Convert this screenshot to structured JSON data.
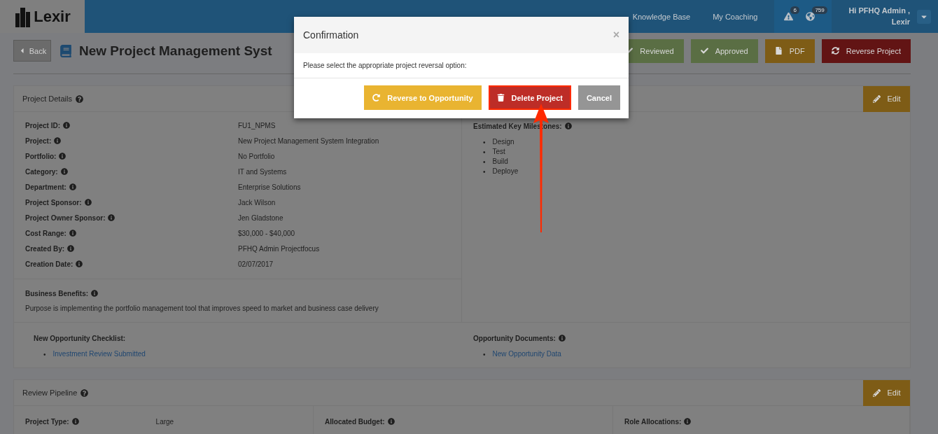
{
  "brand": {
    "name": "Lexir"
  },
  "nav": {
    "items": [
      {
        "label": "Knowledge Base"
      },
      {
        "label": "My Coaching"
      }
    ],
    "alerts": [
      {
        "kind": "warning",
        "count": "6"
      },
      {
        "kind": "globe",
        "count": "759"
      }
    ],
    "user": {
      "greeting": "Hi PFHQ Admin ,",
      "name": "Lexir"
    }
  },
  "header": {
    "back": "Back",
    "title": "New Project Management Syst",
    "actions": [
      {
        "kind": "check",
        "label": "Reviewed",
        "color": "#5a6e44"
      },
      {
        "kind": "check",
        "label": "Approved",
        "color": "#5a6e44"
      },
      {
        "kind": "file",
        "label": "PDF",
        "color": "#7e5c16"
      },
      {
        "kind": "refresh",
        "label": "Reverse Project",
        "color": "#621414"
      }
    ]
  },
  "details": {
    "title": "Project Details",
    "edit": "Edit",
    "fields": [
      {
        "label": "Project ID:",
        "value": "FU1_NPMS"
      },
      {
        "label": "Project:",
        "value": "New Project Management System Integration"
      },
      {
        "label": "Portfolio:",
        "value": "No Portfolio"
      },
      {
        "label": "Category:",
        "value": "IT and Systems"
      },
      {
        "label": "Department:",
        "value": "Enterprise Solutions"
      },
      {
        "label": "Project Sponsor:",
        "value": "Jack Wilson"
      },
      {
        "label": "Project Owner Sponsor:",
        "value": "Jen Gladstone"
      },
      {
        "label": "Cost Range:",
        "value": "$30,000 - $40,000"
      },
      {
        "label": "Created By:",
        "value": "PFHQ Admin Projectfocus"
      },
      {
        "label": "Creation Date:",
        "value": "02/07/2017"
      }
    ],
    "milestones": {
      "label": "Estimated Key Milestones:",
      "bullet": "•",
      "items": [
        "Design",
        "Test",
        "Build",
        "Deploye"
      ]
    },
    "benefits": {
      "label": "Business Benefits:",
      "text": "Purpose is implementing the portfolio management tool that improves speed to market and business case delivery"
    },
    "checklist": {
      "label": "New Opportunity Checklist:",
      "bullet": "•",
      "links": [
        "Investment Review Submitted"
      ]
    },
    "documents": {
      "label": "Opportunity Documents:",
      "bullet": "•",
      "links": [
        "New Opportunity Data"
      ]
    }
  },
  "pipeline": {
    "title": "Review Pipeline",
    "edit": "Edit",
    "columns": [
      {
        "label": "Project Type:",
        "value": "Large"
      },
      {
        "label": "Allocated Budget:"
      },
      {
        "label": "Role Allocations:"
      }
    ]
  },
  "dialog": {
    "title": "Confirmation",
    "close": "×",
    "message": "Please select the appropriate project reversal option:",
    "buttons": [
      {
        "kind": "reverse",
        "label": "Reverse to Opportunity",
        "highlighted": false
      },
      {
        "kind": "delete",
        "label": "Delete Project",
        "highlighted": true
      },
      {
        "kind": "cancel",
        "label": "Cancel",
        "highlighted": false
      }
    ]
  }
}
